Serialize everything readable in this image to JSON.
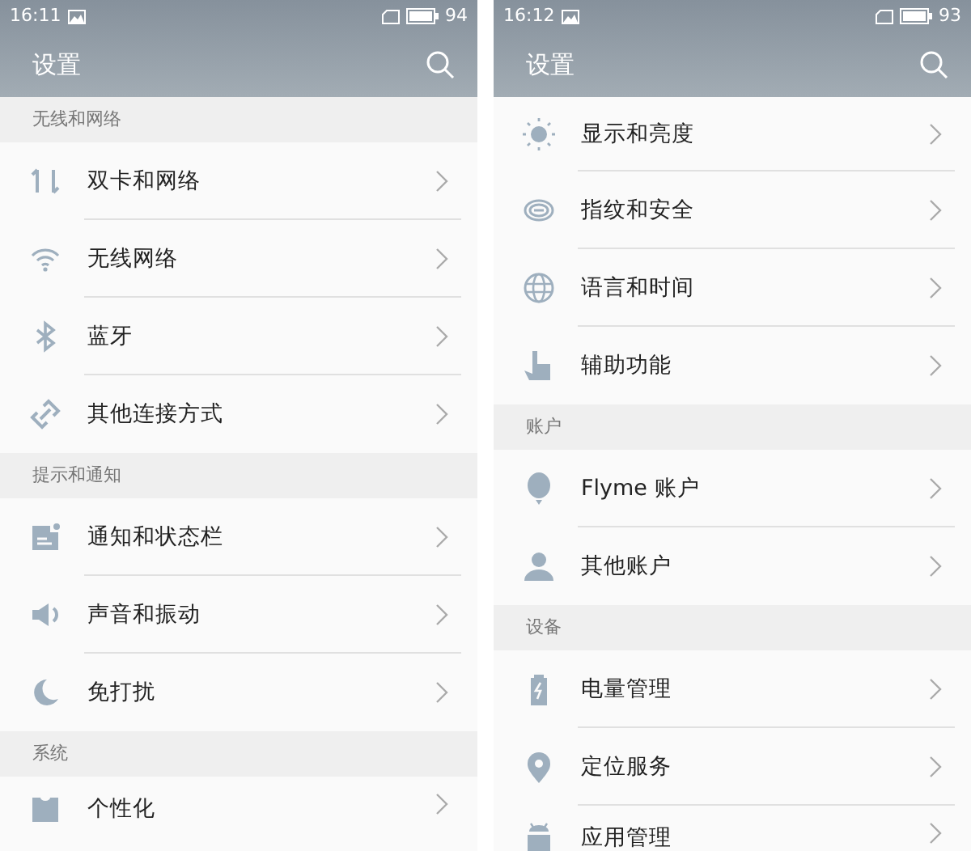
{
  "screens": [
    {
      "status_bar": {
        "time": "16:11",
        "battery": "94"
      },
      "title": "设置",
      "sections": [
        {
          "header": "无线和网络",
          "items": [
            {
              "label": "双卡和网络"
            },
            {
              "label": "无线网络"
            },
            {
              "label": "蓝牙"
            },
            {
              "label": "其他连接方式"
            }
          ]
        },
        {
          "header": "提示和通知",
          "items": [
            {
              "label": "通知和状态栏"
            },
            {
              "label": "声音和振动"
            },
            {
              "label": "免打扰"
            }
          ]
        },
        {
          "header": "系统",
          "items": [
            {
              "label": "个性化"
            }
          ]
        }
      ]
    },
    {
      "status_bar": {
        "time": "16:12",
        "battery": "93"
      },
      "title": "设置",
      "sections": [
        {
          "items": [
            {
              "label": "显示和亮度"
            },
            {
              "label": "指纹和安全"
            },
            {
              "label": "语言和时间"
            },
            {
              "label": "辅助功能"
            }
          ]
        },
        {
          "header": "账户",
          "items": [
            {
              "label": "Flyme 账户"
            },
            {
              "label": "其他账户"
            }
          ]
        },
        {
          "header": "设备",
          "items": [
            {
              "label": "电量管理"
            },
            {
              "label": "定位服务"
            },
            {
              "label": "应用管理"
            }
          ]
        }
      ]
    }
  ]
}
